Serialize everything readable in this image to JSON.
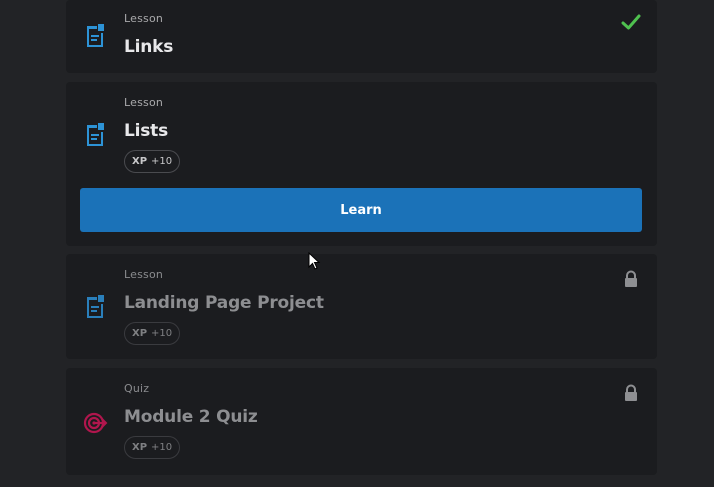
{
  "items": [
    {
      "type_label": "Lesson",
      "title": "Links",
      "status": "completed",
      "icon": "lesson-document-icon",
      "status_icon": "checkmark-icon"
    },
    {
      "type_label": "Lesson",
      "title": "Lists",
      "xp_label": "XP",
      "xp_value": "+10",
      "icon": "lesson-document-icon",
      "button_label": "Learn"
    },
    {
      "type_label": "Lesson",
      "title": "Landing Page Project",
      "xp_label": "XP",
      "xp_value": "+10",
      "status": "locked",
      "icon": "lesson-document-icon",
      "status_icon": "lock-icon"
    },
    {
      "type_label": "Quiz",
      "title": "Module 2 Quiz",
      "xp_label": "XP",
      "xp_value": "+10",
      "status": "locked",
      "icon": "quiz-target-icon",
      "status_icon": "lock-icon"
    }
  ],
  "colors": {
    "background": "#222326",
    "card": "#1b1c1f",
    "accent_blue": "#1b72b8",
    "lesson_icon": "#2d93d6",
    "quiz_icon": "#b0164d",
    "check_green": "#4fc14f"
  }
}
